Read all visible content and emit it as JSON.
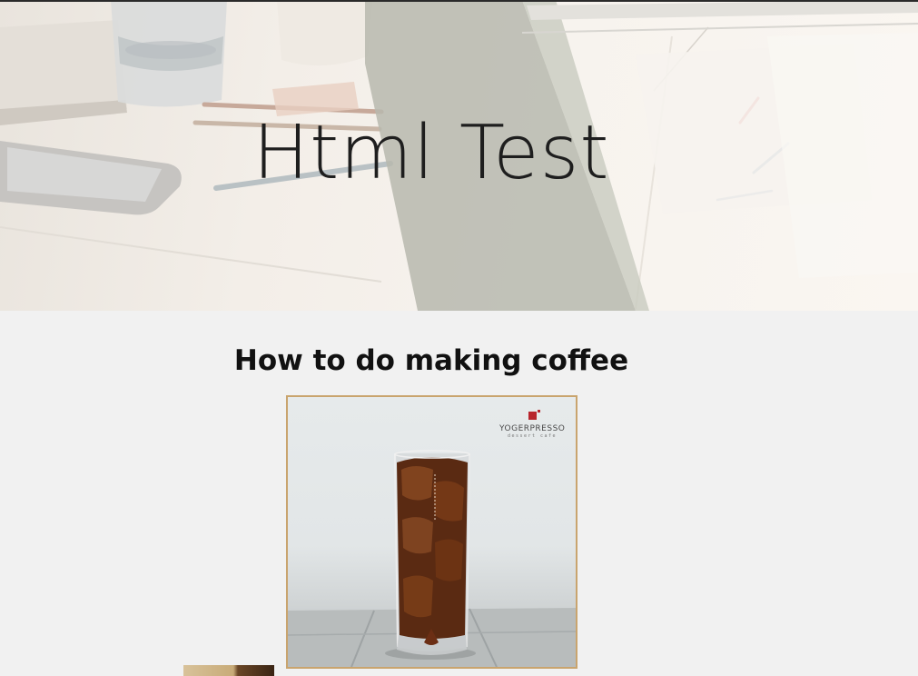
{
  "hero": {
    "title": "Html Test"
  },
  "section": {
    "title": "How to do making coffee"
  },
  "photo": {
    "brand_name": "YOGERPRESSO",
    "brand_sub": "dessert cafe",
    "icon": "iced-coffee-glass-image"
  },
  "colors": {
    "page_background": "#f1f1f1",
    "frame_border": "#c9a46e",
    "brand_red": "#b8252c"
  }
}
